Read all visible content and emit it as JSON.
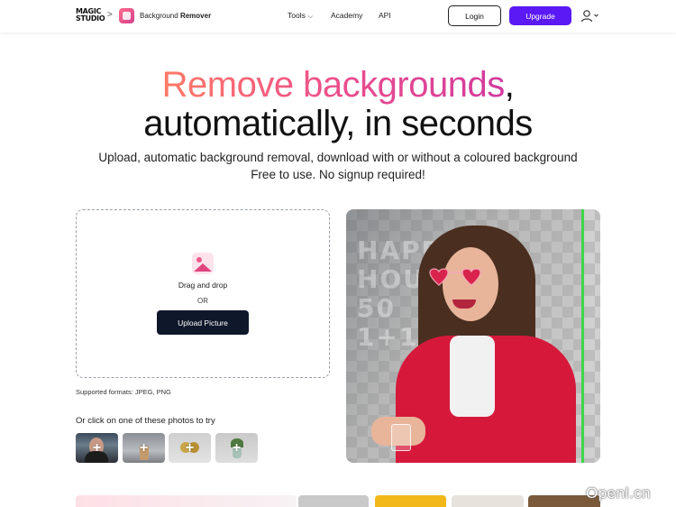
{
  "header": {
    "logo": {
      "line1": "MAGIC",
      "line2": "STUDIO"
    },
    "breadcrumb_separator": ">",
    "app": {
      "name_regular": "Background",
      "name_bold": "Remover"
    },
    "nav": [
      {
        "label": "Tools",
        "has_dropdown": true
      },
      {
        "label": "Academy"
      },
      {
        "label": "API"
      }
    ],
    "login_label": "Login",
    "upgrade_label": "Upgrade",
    "upgrade_color": "#5a19f5"
  },
  "hero": {
    "title_highlight": "Remove backgrounds",
    "title_comma": ",",
    "title_line2": "automatically, in seconds",
    "subtitle_line1": "Upload, automatic background removal, download with or without a coloured background",
    "subtitle_line2": "Free to use. No signup required!"
  },
  "upload": {
    "drag_text": "Drag and drop",
    "or_text": "OR",
    "button_label": "Upload Picture",
    "supported_formats": "Supported formats: JPEG, PNG"
  },
  "samples": {
    "label": "Or click on one of these photos to try",
    "items": [
      {
        "name": "portrait",
        "plus": "+"
      },
      {
        "name": "bottle",
        "plus": "+"
      },
      {
        "name": "rings",
        "plus": "+"
      },
      {
        "name": "plant",
        "plus": "+"
      }
    ]
  },
  "preview": {
    "background_text_line1": "HAPPY",
    "background_text_line2": "HOUR",
    "background_text_line3": "50",
    "background_text_line4": "1+1",
    "divider_color": "#3ed64a"
  },
  "watermark": "Openl.cn"
}
